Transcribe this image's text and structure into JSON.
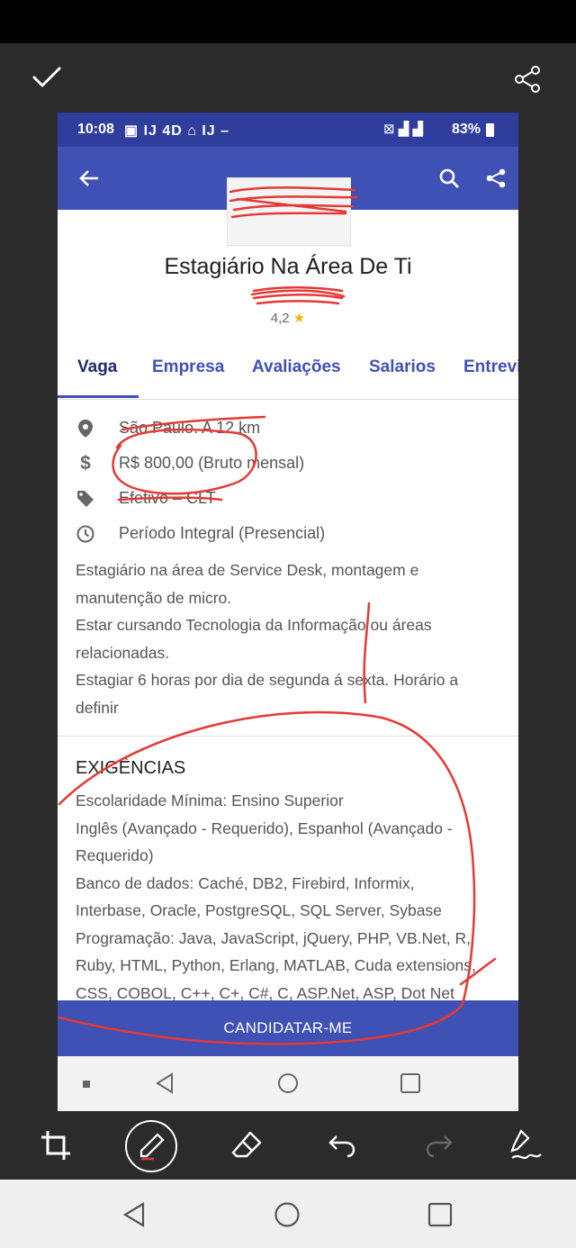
{
  "status": {
    "time": "10:08",
    "notification_icons": "▣ IJ 4D ⌂ IJ –",
    "battery": "83%"
  },
  "job": {
    "title": "Estagiário Na Área De Ti",
    "rating": "4,2"
  },
  "tabs": [
    "Vaga",
    "Empresa",
    "Avaliações",
    "Salarios",
    "Entrevi"
  ],
  "details": {
    "location": "São Paulo. A 12 km",
    "salary": "R$ 800,00 (Bruto mensal)",
    "contract": "Efetivo – CLT",
    "schedule": "Período Integral (Presencial)"
  },
  "description": [
    "Estagiário na área de Service Desk, montagem e",
    "manutenção de micro.",
    "Estar cursando Tecnologia da Informação ou áreas",
    "relacionadas.",
    "Estagiar 6 horas por dia de segunda á sexta. Horário a",
    "definir"
  ],
  "requirements": {
    "title": "EXIGÊNCIAS",
    "lines": [
      "Escolaridade Mínima: Ensino Superior",
      "Inglês (Avançado - Requerido), Espanhol (Avançado -",
      "Requerido)",
      "Banco de dados: Caché, DB2, Firebird, Informix,",
      "Interbase, Oracle, PostgreSQL, SQL Server, Sybase",
      "Programação: Java, JavaScript, jQuery, PHP, VB.Net, R,",
      "Ruby, HTML, Python, Erlang, MATLAB, Cuda extensions,",
      "CSS, COBOL, C++, C+, C#, C, ASP.Net, ASP, Dot Net"
    ]
  },
  "cta_label": "CANDIDATAR-ME",
  "colors": {
    "primary": "#3f51b5",
    "status_bar": "#2f3d9c",
    "annotation": "#e53935",
    "editor_bg": "#2b2b2b"
  },
  "icons": {
    "editor_top": [
      "check-icon",
      "share-icon"
    ],
    "editor_tools": [
      "crop-icon",
      "pen-icon",
      "eraser-icon",
      "undo-icon",
      "redo-icon",
      "signature-icon"
    ],
    "details": [
      "location-icon",
      "dollar-icon",
      "tag-icon",
      "clock-icon"
    ]
  }
}
